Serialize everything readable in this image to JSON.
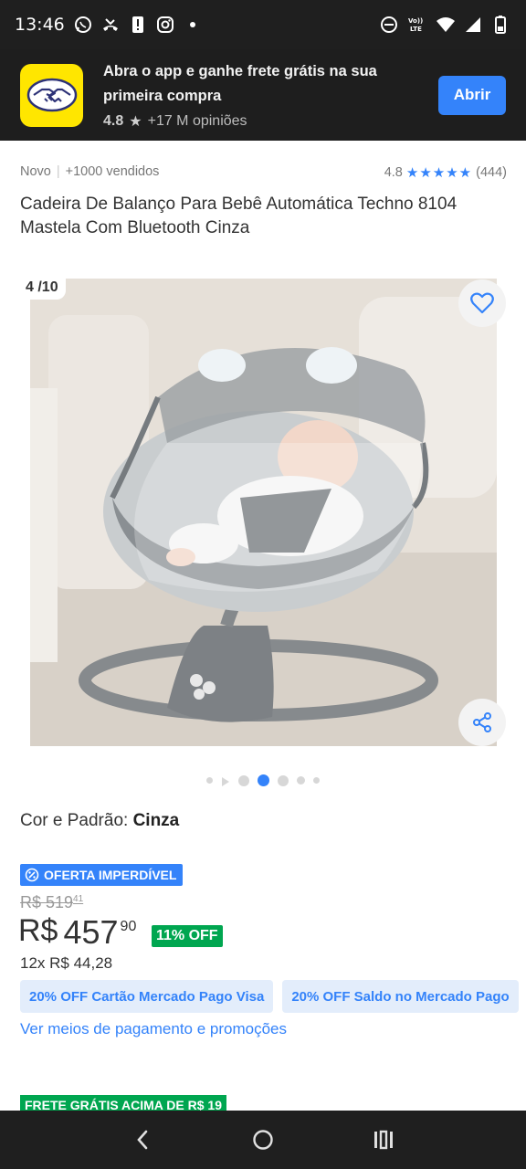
{
  "status_bar": {
    "time": "13:46",
    "left_icons": [
      "whatsapp-icon",
      "missed-call-icon",
      "alert-icon",
      "instagram-icon",
      "more-dot-icon"
    ],
    "right_icons": [
      "do-not-disturb-icon",
      "volte-icon",
      "wifi-icon",
      "signal-icon",
      "battery-icon"
    ],
    "volte_label": "Vo)) LTE"
  },
  "app_banner": {
    "headline": "Abra o app e ganhe frete grátis na sua primeira compra",
    "rating": "4.8",
    "reviews": "+17 M opiniões",
    "open_button": "Abrir",
    "logo_icon": "handshake-icon",
    "logo_color": "#ffe600"
  },
  "product": {
    "condition": "Novo",
    "sold": "+1000 vendidos",
    "rating": "4.8",
    "stars": "★★★★★",
    "review_count": "(444)",
    "title": "Cadeira De Balanço Para Bebê Automática Techno 8104 Mastela Com Bluetooth Cinza"
  },
  "gallery": {
    "counter": "4 /10",
    "current_index": 4,
    "total": 10,
    "favorite_icon": "heart-icon",
    "share_icon": "share-icon",
    "image_description_icon": "baby-swing-photo"
  },
  "variant": {
    "label": "Cor e Padrão: ",
    "value": "Cinza"
  },
  "pricing": {
    "offer_badge": "OFERTA IMPERDÍVEL",
    "old_price_main": "R$ 519",
    "old_price_cents": "41",
    "currency": "R$",
    "price_int": "457",
    "price_cents": "90",
    "discount": "11% OFF",
    "installments": "12x R$ 44,28",
    "promos": [
      "20% OFF Cartão Mercado Pago Visa",
      "20% OFF Saldo no Mercado Pago"
    ],
    "payment_link": "Ver meios de pagamento e promoções",
    "free_shipping": "FRETE GRÁTIS ACIMA DE R$ 19"
  },
  "colors": {
    "accent": "#3483fa",
    "success": "#00a650",
    "brand_yellow": "#ffe600"
  },
  "nav_bar": {
    "icons": [
      "back-icon",
      "home-icon",
      "recents-icon"
    ]
  }
}
